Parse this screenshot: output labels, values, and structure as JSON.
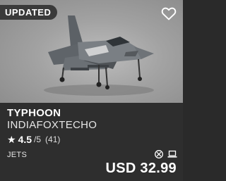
{
  "badge": {
    "label": "UPDATED"
  },
  "favorite": {
    "icon": "heart-outline-icon"
  },
  "product": {
    "title": "TYPHOON",
    "creator": "INDIAFOXTECHO",
    "rating": {
      "score": "4.5",
      "scale": "/5",
      "count": "(41)"
    },
    "category": "JETS",
    "platforms": [
      "xbox-icon",
      "pc-laptop-icon"
    ],
    "price": "USD 32.99"
  },
  "colors": {
    "card_bg": "#2e2e2e",
    "badge_bg": "#3a3a3a",
    "text": "#ffffff"
  }
}
